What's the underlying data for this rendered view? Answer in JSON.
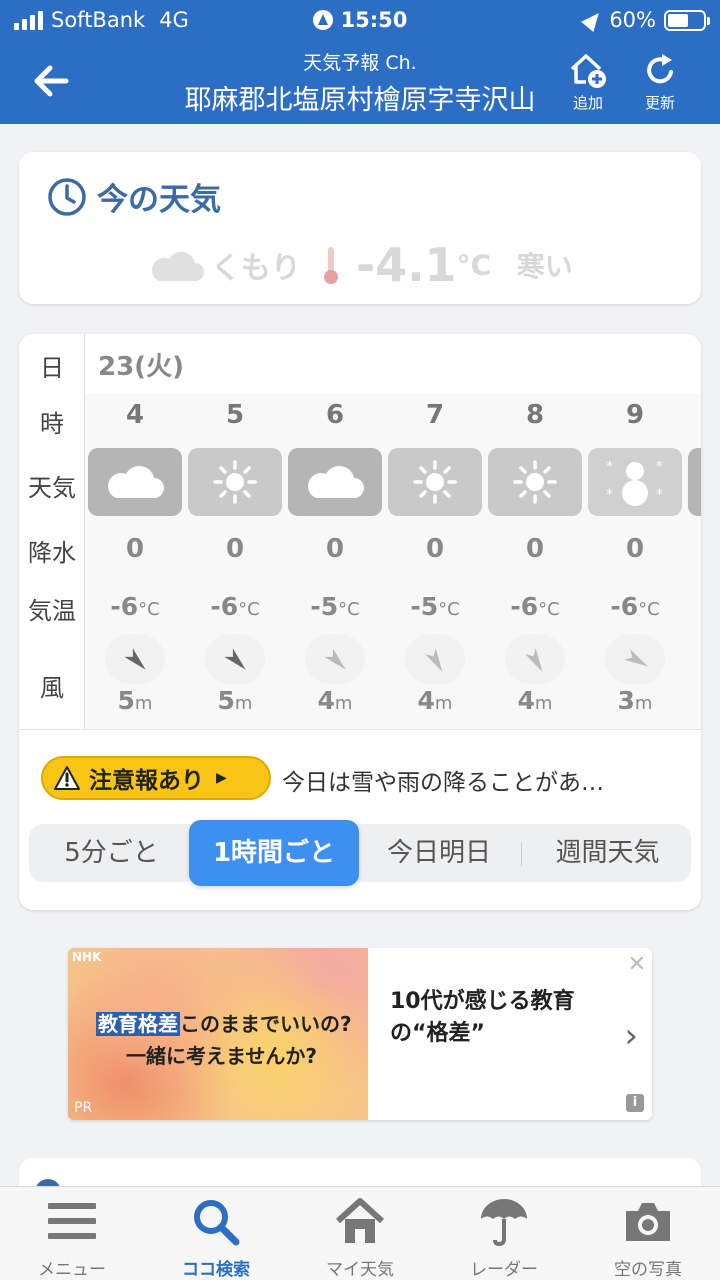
{
  "status": {
    "carrier": "SoftBank",
    "network": "4G",
    "time": "15:50",
    "battery": "60%",
    "battery_level": 0.6
  },
  "header": {
    "subtitle": "天気予報 Ch.",
    "title": "耶麻郡北塩原村檜原字寺沢山",
    "add_label": "追加",
    "refresh_label": "更新"
  },
  "now": {
    "title": "今の天気",
    "condition": "くもり",
    "temperature": "-4.1",
    "unit": "°C",
    "feel": "寒い"
  },
  "forecast": {
    "labels": {
      "day": "日",
      "hour": "時",
      "weather": "天気",
      "precip": "降水",
      "temp": "気温",
      "wind": "風"
    },
    "date": "23(火)",
    "hours": [
      {
        "hour": "4",
        "icon": "cloud-icon",
        "precip": "0",
        "temp": "-6",
        "wind": "5",
        "wind_dir_deg": 135
      },
      {
        "hour": "5",
        "icon": "sun-icon",
        "precip": "0",
        "temp": "-6",
        "wind": "5",
        "wind_dir_deg": 135
      },
      {
        "hour": "6",
        "icon": "cloud-icon",
        "precip": "0",
        "temp": "-5",
        "wind": "4",
        "wind_dir_deg": 135
      },
      {
        "hour": "7",
        "icon": "sun-icon",
        "precip": "0",
        "temp": "-5",
        "wind": "4",
        "wind_dir_deg": 150
      },
      {
        "hour": "8",
        "icon": "sun-icon",
        "precip": "0",
        "temp": "-6",
        "wind": "4",
        "wind_dir_deg": 150
      },
      {
        "hour": "9",
        "icon": "snowman-icon",
        "precip": "0",
        "temp": "-6",
        "wind": "3",
        "wind_dir_deg": 120
      },
      {
        "hour": "",
        "icon": "cloud-icon",
        "precip": "",
        "temp": "-",
        "wind": "",
        "wind_dir_deg": 135
      }
    ],
    "temp_unit": "°C",
    "wind_unit": "m"
  },
  "alert": {
    "badge": "注意報あり",
    "text": "今日は雪や雨の降ることがあ…"
  },
  "segments": {
    "opt1": "5分ごと",
    "opt2": "1時間ごと",
    "opt3": "今日明日",
    "opt4": "週間天気",
    "active": 1
  },
  "ad": {
    "brand": "NHK",
    "highlight": "教育格差",
    "line1_rest": "このままでいいの?",
    "line2": "一緒に考えませんか?",
    "pr": "PR",
    "text": "10代が感じる教育の“格差”"
  },
  "tabs": {
    "menu": "メニュー",
    "search": "ココ検索",
    "my": "マイ天気",
    "radar": "レーダー",
    "sky": "空の写真"
  },
  "colors": {
    "brand_blue": "#2c6ec4",
    "accent_blue": "#3d8ff0",
    "alert_yellow": "#f8c516",
    "section_title": "#3b6aa6"
  }
}
